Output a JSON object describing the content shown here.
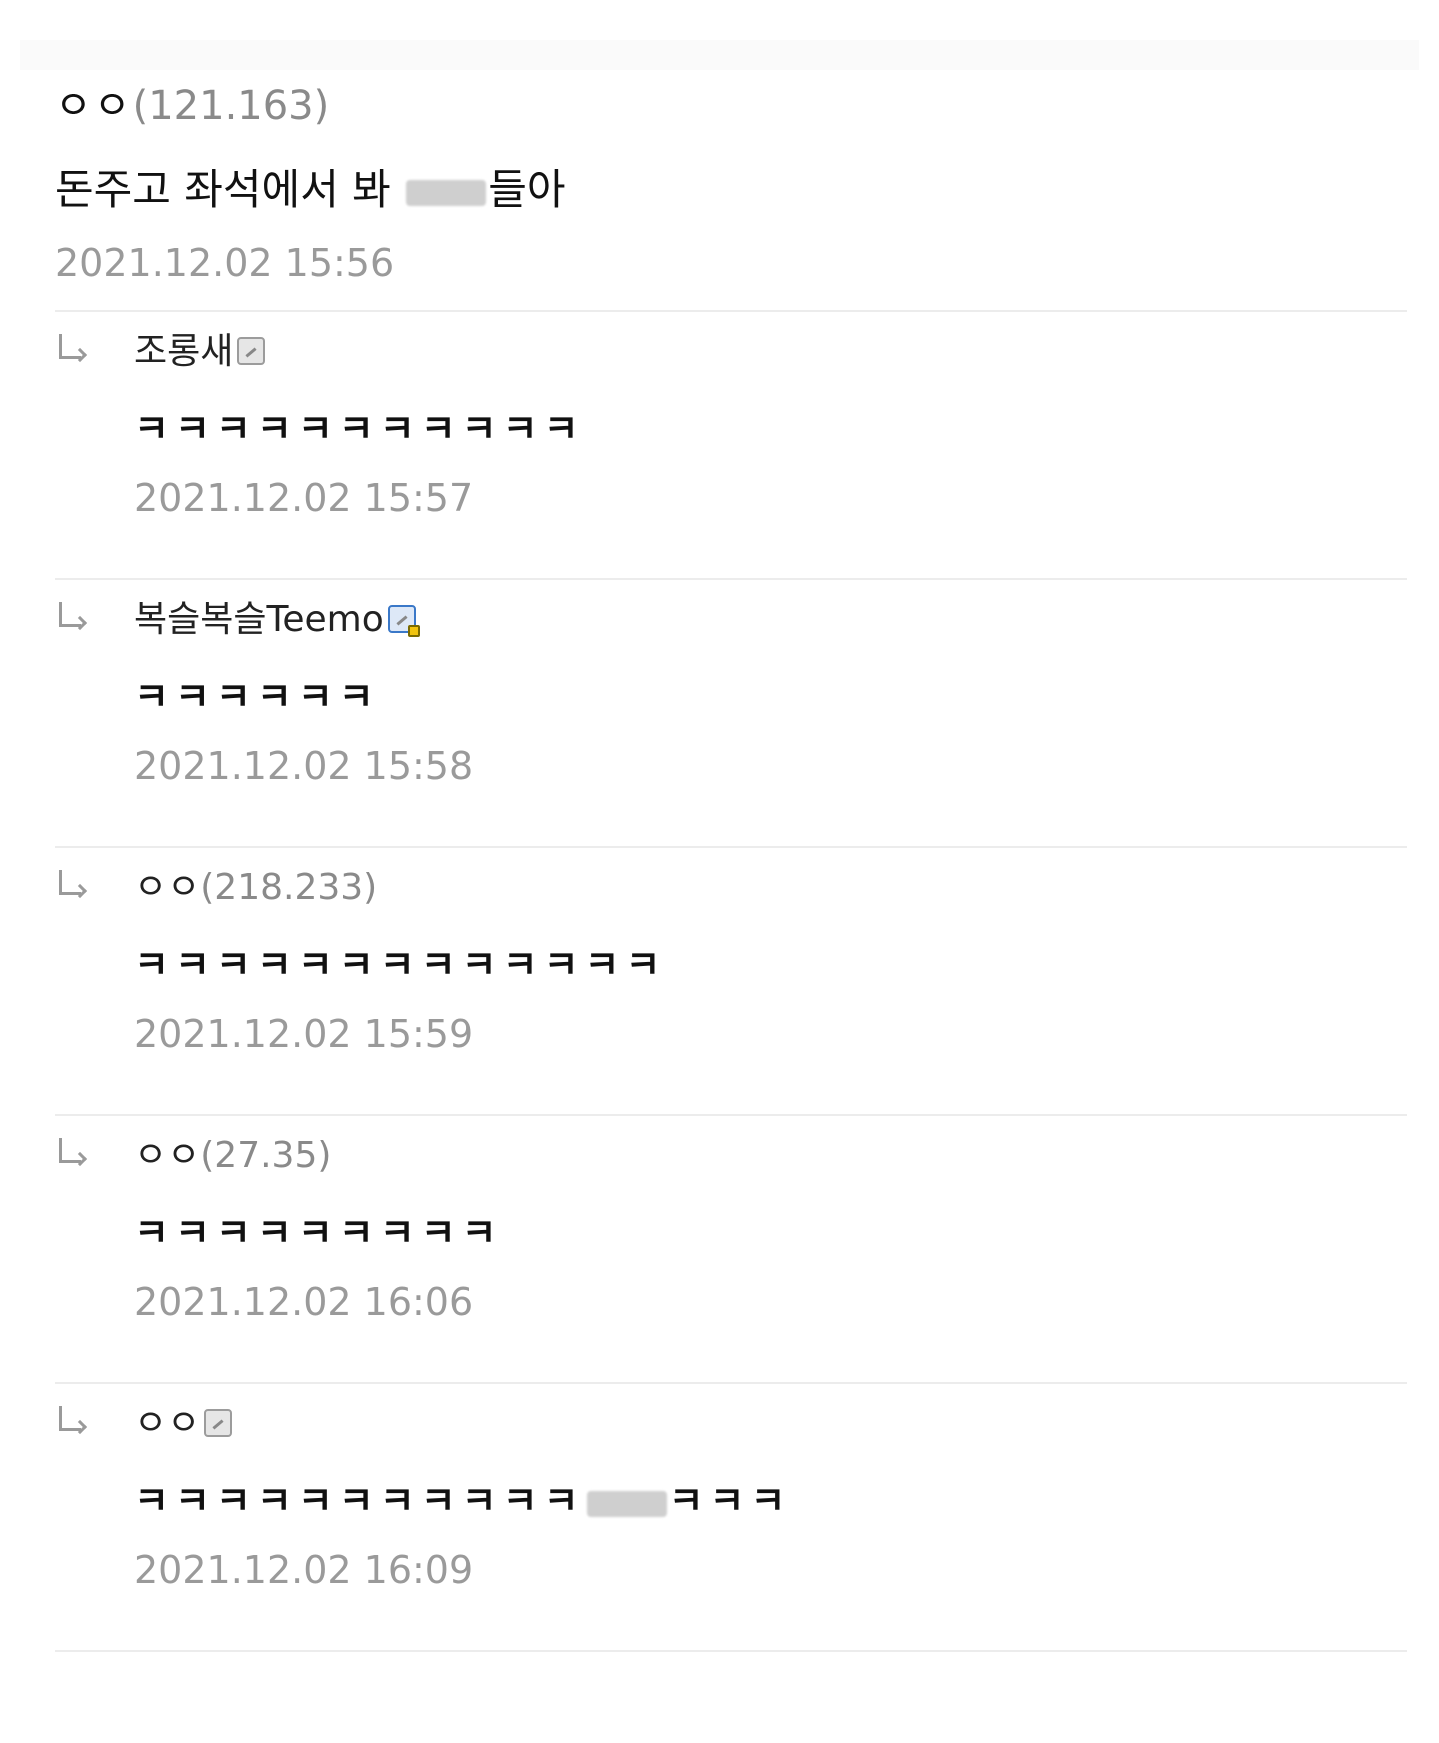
{
  "post": {
    "nickname": "ㅇㅇ",
    "ip": "(121.163)",
    "text_before": "돈주고 좌석에서 봐 ",
    "text_after": "들아",
    "date": "2021.12.02 15:56"
  },
  "replies": [
    {
      "nickname": "조롱새",
      "ip": "",
      "badge": "gallog-icon",
      "text": "ㅋㅋㅋㅋㅋㅋㅋㅋㅋㅋㅋ",
      "date": "2021.12.02 15:57"
    },
    {
      "nickname": "복슬복슬Teemo",
      "ip": "",
      "badge": "fixed-nick-icon",
      "text": "ㅋㅋㅋㅋㅋㅋ",
      "date": "2021.12.02 15:58"
    },
    {
      "nickname": "ㅇㅇ",
      "ip": "(218.233)",
      "badge": "",
      "text": "ㅋㅋㅋㅋㅋㅋㅋㅋㅋㅋㅋㅋㅋ",
      "date": "2021.12.02 15:59"
    },
    {
      "nickname": "ㅇㅇ",
      "ip": "(27.35)",
      "badge": "",
      "text": "ㅋㅋㅋㅋㅋㅋㅋㅋㅋ",
      "date": "2021.12.02 16:06"
    },
    {
      "nickname": "ㅇㅇ",
      "ip": "",
      "badge": "gallog-icon",
      "text_before": "ㅋㅋㅋㅋㅋㅋㅋㅋㅋㅋㅋ",
      "text_after": "ㅋㅋㅋ",
      "date": "2021.12.02 16:09"
    }
  ]
}
